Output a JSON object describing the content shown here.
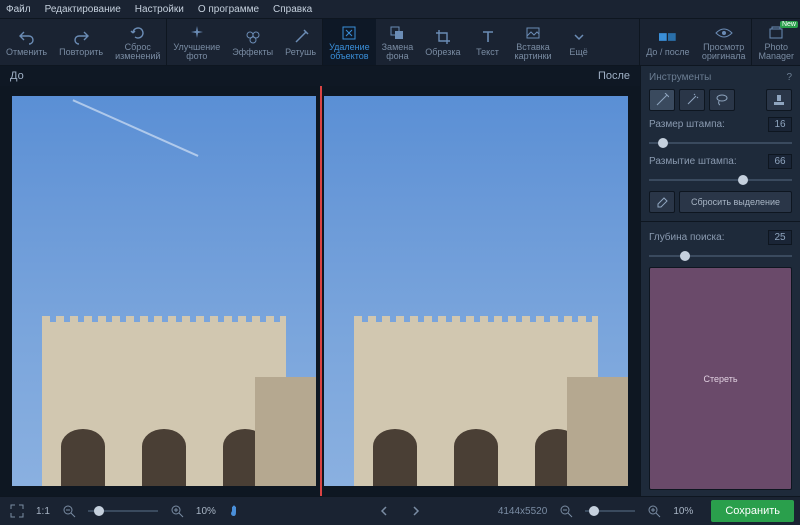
{
  "menu": {
    "file": "Файл",
    "edit": "Редактирование",
    "settings": "Настройки",
    "about": "О программе",
    "help": "Справка"
  },
  "toolbar": {
    "undo": "Отменить",
    "redo": "Повторить",
    "reset": "Сброс\nизменений",
    "enhance": "Улучшение\nфото",
    "effects": "Эффекты",
    "retouch": "Ретушь",
    "remove_obj": "Удаление\nобъектов",
    "replace_bg": "Замена\nфона",
    "crop": "Обрезка",
    "text": "Текст",
    "insert_img": "Вставка\nкартинки",
    "more": "Ещё",
    "before_after": "До / после",
    "view_original": "Просмотр\nоригинала",
    "photo_manager": "Photo\nManager",
    "new_badge": "New"
  },
  "canvas": {
    "before": "До",
    "after": "После"
  },
  "panel": {
    "title": "Инструменты",
    "help": "?",
    "stamp_size_label": "Размер штампа:",
    "stamp_size_val": "16",
    "stamp_blur_label": "Размытие штампа:",
    "stamp_blur_val": "66",
    "reset_selection": "Сбросить выделение",
    "search_depth_label": "Глубина поиска:",
    "search_depth_val": "25",
    "erase": "Стереть"
  },
  "status": {
    "fit": "1:1",
    "zoom": "10%",
    "dimensions": "4144x5520",
    "zoom2": "10%",
    "save": "Сохранить"
  }
}
